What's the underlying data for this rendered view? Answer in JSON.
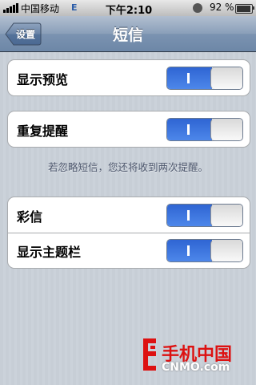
{
  "status_bar": {
    "carrier": "中国移动",
    "network": "E",
    "time": "下午2:10",
    "battery_percent": "92 %",
    "battery_level": 0.92
  },
  "nav": {
    "back_label": "设置",
    "title": "短信"
  },
  "groups": {
    "preview": {
      "label": "显示预览",
      "on": true
    },
    "repeat_alert": {
      "label": "重复提醒",
      "on": true
    },
    "repeat_alert_note": "若忽略短信，您还将收到两次提醒。",
    "mms": {
      "label": "彩信",
      "on": true
    },
    "subject_field": {
      "label": "显示主题栏",
      "on": true
    }
  },
  "watermark": {
    "cn": "手机中国",
    "en": "CNMO.com"
  },
  "colors": {
    "switch_on": "#3a74e0",
    "nav_bar": "#7b93b1",
    "background": "#c5ccd4"
  }
}
